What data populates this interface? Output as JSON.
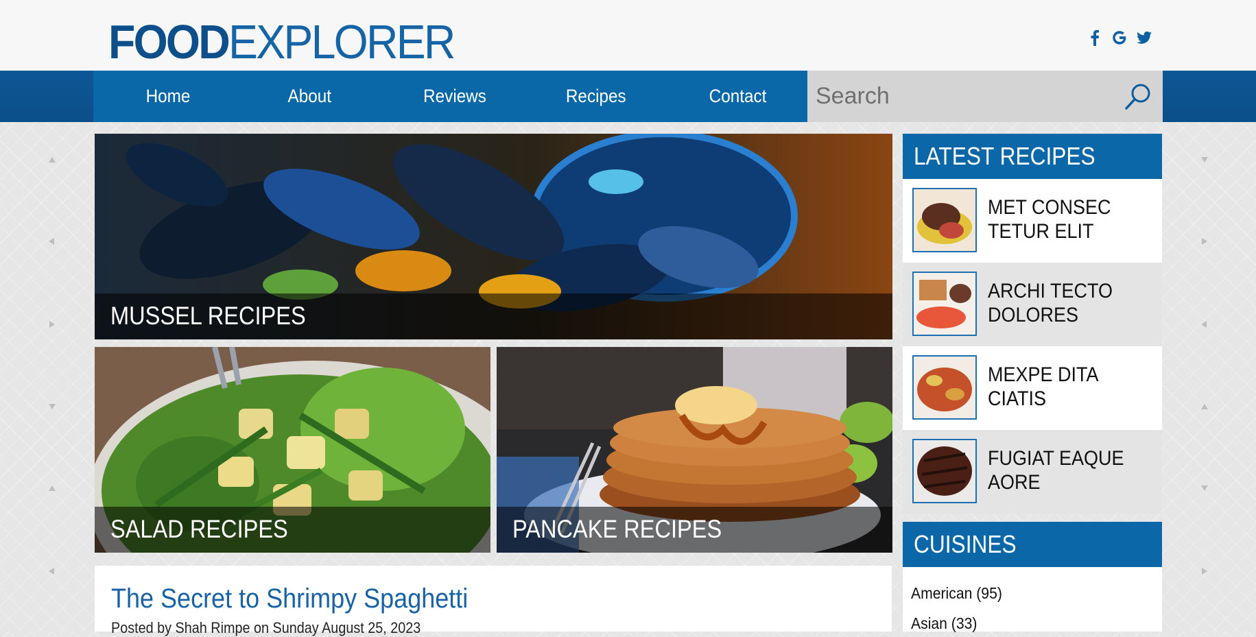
{
  "logo": {
    "bold": "FOOD",
    "normal": "EXPLORER"
  },
  "social": [
    {
      "icon": "facebook-icon",
      "glyph": "f"
    },
    {
      "icon": "google-icon",
      "glyph": "G"
    },
    {
      "icon": "twitter-icon",
      "glyph": ""
    }
  ],
  "nav": [
    {
      "label": "Home"
    },
    {
      "label": "About"
    },
    {
      "label": "Reviews"
    },
    {
      "label": "Recipes"
    },
    {
      "label": "Contact"
    }
  ],
  "search": {
    "placeholder": "Search",
    "icon": "search-icon"
  },
  "featured": [
    {
      "caption": "MUSSEL RECIPES"
    },
    {
      "caption": "SALAD RECIPES"
    },
    {
      "caption": "PANCAKE RECIPES"
    }
  ],
  "article": {
    "title": "The Secret to Shrimpy Spaghetti",
    "meta": "Posted by Shah Rimpe on Sunday August 25, 2023"
  },
  "sidebar": {
    "latest_title": "LATEST RECIPES",
    "latest": [
      {
        "title": "MET CONSEC TETUR ELIT"
      },
      {
        "title": "ARCHI TECTO DOLORES"
      },
      {
        "title": "MEXPE DITA CIATIS"
      },
      {
        "title": "FUGIAT EAQUE AORE"
      }
    ],
    "cuisines_title": "CUISINES",
    "cuisines": [
      {
        "label": "American (95)"
      },
      {
        "label": "Asian (33)"
      }
    ]
  },
  "colors": {
    "brand": "#0a67a8",
    "brand_dark": "#0b4f88",
    "title_blue": "#1762a7",
    "search_bg": "#d4d4d4"
  }
}
